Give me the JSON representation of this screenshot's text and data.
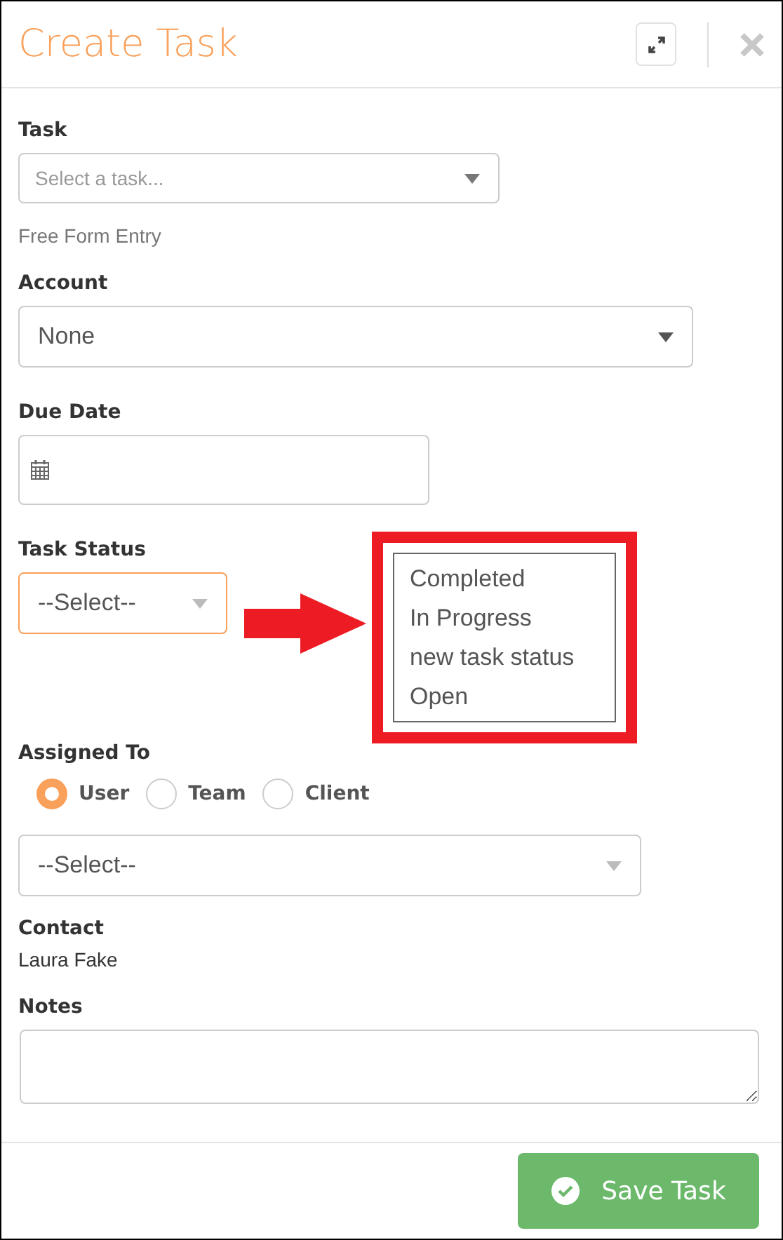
{
  "window": {
    "title": "Create Task"
  },
  "task": {
    "label": "Task",
    "placeholder": "Select a task...",
    "hint": "Free Form Entry"
  },
  "account": {
    "label": "Account",
    "value": "None"
  },
  "due_date": {
    "label": "Due Date"
  },
  "task_status": {
    "label": "Task Status",
    "value": "--Select--",
    "focused": true
  },
  "status_options": [
    "Completed",
    "In Progress",
    "new task status",
    "Open"
  ],
  "assigned_to": {
    "label": "Assigned To",
    "options": [
      {
        "label": "User",
        "selected": true
      },
      {
        "label": "Team",
        "selected": false
      },
      {
        "label": "Client",
        "selected": false
      }
    ],
    "value": "--Select--"
  },
  "contact": {
    "label": "Contact",
    "value": "Laura Fake"
  },
  "notes": {
    "label": "Notes"
  },
  "save_button": "Save Task"
}
